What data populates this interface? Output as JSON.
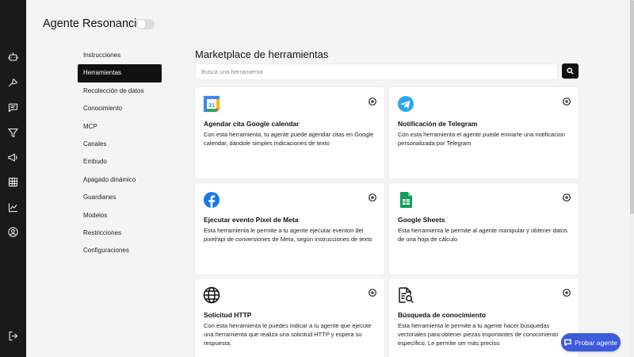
{
  "header": {
    "title": "Agente Resonancias",
    "active_toggle": false
  },
  "rail": {
    "icons": [
      "bot-icon",
      "flow-icon",
      "chat-icon",
      "funnel-icon",
      "megaphone-icon",
      "table-icon",
      "chart-icon",
      "user-circle-icon"
    ],
    "logout": "logout-icon"
  },
  "subnav": {
    "items": [
      {
        "label": "Instrucciones"
      },
      {
        "label": "Herramientas",
        "active": true
      },
      {
        "label": "Recolección de datos"
      },
      {
        "label": "Conocimiento"
      },
      {
        "label": "MCP"
      },
      {
        "label": "Canales"
      },
      {
        "label": "Embudo"
      },
      {
        "label": "Apagado dinámico"
      },
      {
        "label": "Guardianes"
      },
      {
        "label": "Modelos"
      },
      {
        "label": "Restricciones"
      },
      {
        "label": "Configuraciones"
      }
    ]
  },
  "marketplace": {
    "title": "Marketplace de herramientas",
    "search_placeholder": "Busca una herramienta",
    "cards": [
      {
        "icon": "google-calendar-icon",
        "calendar_day": "31",
        "name": "Agendar cita Google calendar",
        "description": "Con esta herramienta, tu agente puede agendar citas en Google calendar, dándole simples indicaciones de texto"
      },
      {
        "icon": "telegram-icon",
        "name": "Notificación de Telegram",
        "description": "Con esta herramienta el agente puede enviarte una notificacion personalizada por Telegram"
      },
      {
        "icon": "facebook-icon",
        "name": "Ejecutar evento Pixel de Meta",
        "description": "Esta herramienta le permite a tu agente ejecutar eventon del pixel/api de conversiones de Meta, según instrucciones de texto"
      },
      {
        "icon": "google-sheets-icon",
        "name": "Google Sheets",
        "description": "Esta herramienta le permite al agente manipular y obtener datos de una hoja de cálculo"
      },
      {
        "icon": "globe-icon",
        "name": "Solicitud HTTP",
        "description": "Con esta herramienta le puedes indicar a tu agente que ejecute una herramienta que realiza una solicitud HTTP y espera su respuesta."
      },
      {
        "icon": "document-search-icon",
        "name": "Búsqueda de conocimiento",
        "description": "Esta herramienta le permite a tu agente hacer búsquedas vectoriales para obtener piezas importantes de conocimiento específico. Le permite ser más preciso."
      }
    ]
  },
  "try_button": {
    "label": "Probar agente"
  },
  "colors": {
    "rail": "#1a1a1a",
    "accent": "#3b5bdb",
    "active_nav": "#111111",
    "background": "#f4f4f5"
  }
}
